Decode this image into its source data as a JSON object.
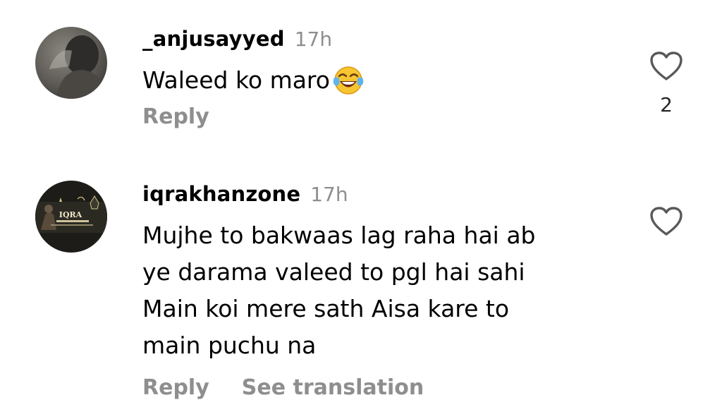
{
  "comments": [
    {
      "username": "_anjusayyed",
      "timestamp": "17h",
      "text": "Waleed ko maro",
      "emoji": "face-with-tears-of-joy",
      "reply_label": "Reply",
      "like_count": "2"
    },
    {
      "username": "iqrakhanzone",
      "timestamp": "17h",
      "text_lines": [
        "Mujhe to bakwaas lag raha hai ab",
        "ye darama valeed to pgl hai sahi",
        "Main koi mere sath Aisa kare to",
        "main puchu na"
      ],
      "reply_label": "Reply",
      "translation_label": "See translation",
      "avatar_text": "IQRA"
    }
  ],
  "colors": {
    "secondary_text": "#8e8e8e",
    "primary_text": "#000000"
  }
}
